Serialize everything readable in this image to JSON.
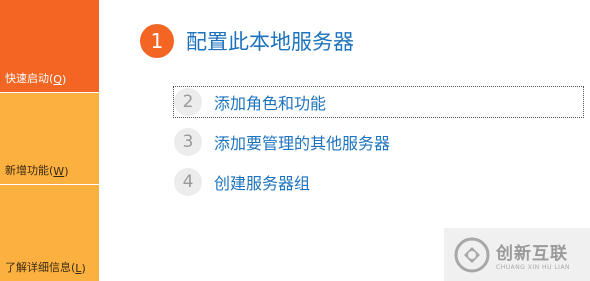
{
  "sidebar": {
    "items": [
      {
        "label": "快速启动(",
        "key": "Q",
        "suffix": ")"
      },
      {
        "label": "新增功能(",
        "key": "W",
        "suffix": ")"
      },
      {
        "label": "了解详细信息(",
        "key": "L",
        "suffix": ")"
      }
    ]
  },
  "main": {
    "step1": {
      "number": "1",
      "title": "配置此本地服务器"
    },
    "tasks": [
      {
        "number": "2",
        "label": "添加角色和功能"
      },
      {
        "number": "3",
        "label": "添加要管理的其他服务器"
      },
      {
        "number": "4",
        "label": "创建服务器组"
      }
    ]
  },
  "watermark": {
    "title": "创新互联",
    "subtitle": "CHUANG XIN HU LIAN"
  },
  "colors": {
    "accent_orange": "#f26522",
    "tile_orange": "#fbb040",
    "link_blue": "#1e73be"
  }
}
